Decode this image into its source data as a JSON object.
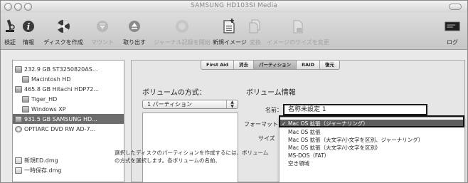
{
  "window": {
    "title": "SAMSUNG HD103SI Media"
  },
  "toolbar": {
    "items": [
      {
        "label": "検証",
        "icon": "microscope-icon",
        "disabled": false
      },
      {
        "label": "情報",
        "icon": "info-icon",
        "disabled": false
      },
      {
        "label": "ディスクを作成",
        "icon": "burn-icon",
        "disabled": false
      },
      {
        "label": "マウント",
        "icon": "mount-icon",
        "disabled": true
      },
      {
        "label": "取り出す",
        "icon": "eject-icon",
        "disabled": false
      },
      {
        "label": "ジャーナル記録を開始",
        "icon": "journal-icon",
        "disabled": true
      },
      {
        "label": "新規イメージ",
        "icon": "new-image-icon",
        "disabled": false
      },
      {
        "label": "変換",
        "icon": "convert-icon",
        "disabled": true
      },
      {
        "label": "イメージのサイズを変更",
        "icon": "resize-image-icon",
        "disabled": true
      },
      {
        "label": "ログ",
        "icon": "log-icon",
        "disabled": false
      }
    ]
  },
  "sidebar": {
    "items": [
      {
        "label": "232.9 GB ST3250820AS...",
        "kind": "drive",
        "selected": false
      },
      {
        "label": "Macintosh HD",
        "kind": "volume",
        "selected": false
      },
      {
        "label": "465.8 GB Hitachi HDP72...",
        "kind": "drive",
        "selected": false
      },
      {
        "label": "Tiger_HD",
        "kind": "volume",
        "selected": false
      },
      {
        "label": "Windows XP",
        "kind": "volume",
        "selected": false
      },
      {
        "label": "931.5 GB SAMSUNG HD...",
        "kind": "drive",
        "selected": true
      },
      {
        "label": "OPTIARC DVD RW AD-7...",
        "kind": "optical",
        "selected": false
      },
      {
        "label": "新規ED.dmg",
        "kind": "dmg",
        "selected": false
      },
      {
        "label": "一時保存.dmg",
        "kind": "dmg",
        "selected": false
      }
    ]
  },
  "tabs": [
    {
      "label": "First Aid",
      "active": false
    },
    {
      "label": "消去",
      "active": false
    },
    {
      "label": "パーティション",
      "active": true
    },
    {
      "label": "RAID",
      "active": false
    },
    {
      "label": "復元",
      "active": false
    }
  ],
  "partition": {
    "scheme_title": "ボリュームの方式：",
    "scheme_value": "1 パーティション",
    "info_title": "ボリューム情報",
    "name_label": "名前：",
    "name_value": "名称未設定 1",
    "format_label": "フォーマット",
    "size_label": "サイズ",
    "description": "選択したディスクのパーティションを作成するには、ボリュームの方式を選択します。各ボリュームの名前、"
  },
  "format_menu": {
    "items": [
      {
        "label": "Mac OS 拡張（ジャーナリング）",
        "selected": true
      },
      {
        "label": "Mac OS 拡張",
        "selected": false
      },
      {
        "label": "Mac OS 拡張（大文字/小文字を区別、ジャーナリング）",
        "selected": false
      },
      {
        "label": "Mac OS 拡張（大文字/小文字を区別）",
        "selected": false
      },
      {
        "label": "MS-DOS（FAT）",
        "selected": false
      },
      {
        "label": "空き領域",
        "selected": false
      }
    ],
    "checkmark": "✓"
  }
}
